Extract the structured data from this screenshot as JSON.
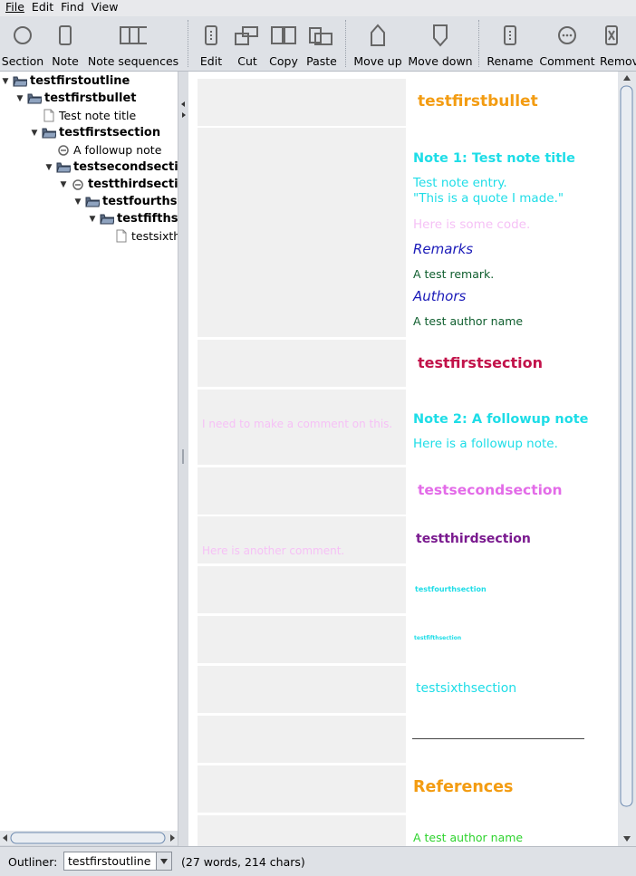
{
  "menu": [
    "File",
    "Edit",
    "Find",
    "View"
  ],
  "toolbar": {
    "section": "Section",
    "note": "Note",
    "note_sequences": "Note sequences",
    "edit": "Edit",
    "cut": "Cut",
    "copy": "Copy",
    "paste": "Paste",
    "move_up": "Move up",
    "move_down": "Move down",
    "rename": "Rename",
    "comment": "Comment",
    "remove": "Remov"
  },
  "tree": [
    {
      "label": "testfirstoutline",
      "bold": true,
      "icon": "folder-open-icon"
    },
    {
      "label": "testfirstbullet",
      "bold": true,
      "icon": "folder-open-icon"
    },
    {
      "label": "Test note title",
      "bold": false,
      "icon": "document-icon"
    },
    {
      "label": "testfirstsection",
      "bold": true,
      "icon": "folder-open-icon"
    },
    {
      "label": "A followup note",
      "bold": false,
      "icon": "minus-circle-icon"
    },
    {
      "label": "testsecondsection",
      "bold": true,
      "icon": "folder-open-icon"
    },
    {
      "label": "testthirdsection",
      "bold": true,
      "icon": "minus-circle-icon"
    },
    {
      "label": "testfourthsection",
      "bold": true,
      "icon": "folder-open-icon"
    },
    {
      "label": "testfifthsection",
      "bold": true,
      "icon": "folder-open-icon"
    },
    {
      "label": "testsixthsection",
      "bold": false,
      "icon": "document-icon"
    }
  ],
  "comments": {
    "first": "I need to make a comment on this.",
    "second": "Here is another comment."
  },
  "content": {
    "bullet_title": "testfirstbullet",
    "note1_title": "Note 1: Test note title",
    "note1_line1": "Test note entry.",
    "note1_line2": "\"This is a quote I made.\"",
    "code_line": "Here is some code.",
    "remarks_heading": "Remarks",
    "remark_text": "A test remark.",
    "authors_heading": "Authors",
    "author_text": "A test author name",
    "section1": "testfirstsection",
    "note2_title": "Note 2: A followup note",
    "note2_text": "Here is a followup note.",
    "section2": "testsecondsection",
    "section3": "testthirdsection",
    "section4": "testfourthsection",
    "section5": "testfifthsection",
    "section6": "testsixthsection",
    "references_heading": "References",
    "reference_text": "A test author name"
  },
  "colors": {
    "orange": "#f39c12",
    "cyan": "#1edde7",
    "crimson": "#c2124a",
    "violet": "#e36be8",
    "purple": "#7a1a8f",
    "navy": "#1a1ab8",
    "darkgreen": "#0f5e2e",
    "green": "#2ed32e",
    "pink": "#f6c1f6"
  },
  "status": {
    "outliner_label": "Outliner:",
    "outliner_value": "testfirstoutline",
    "counts": "(27 words, 214 chars)"
  }
}
